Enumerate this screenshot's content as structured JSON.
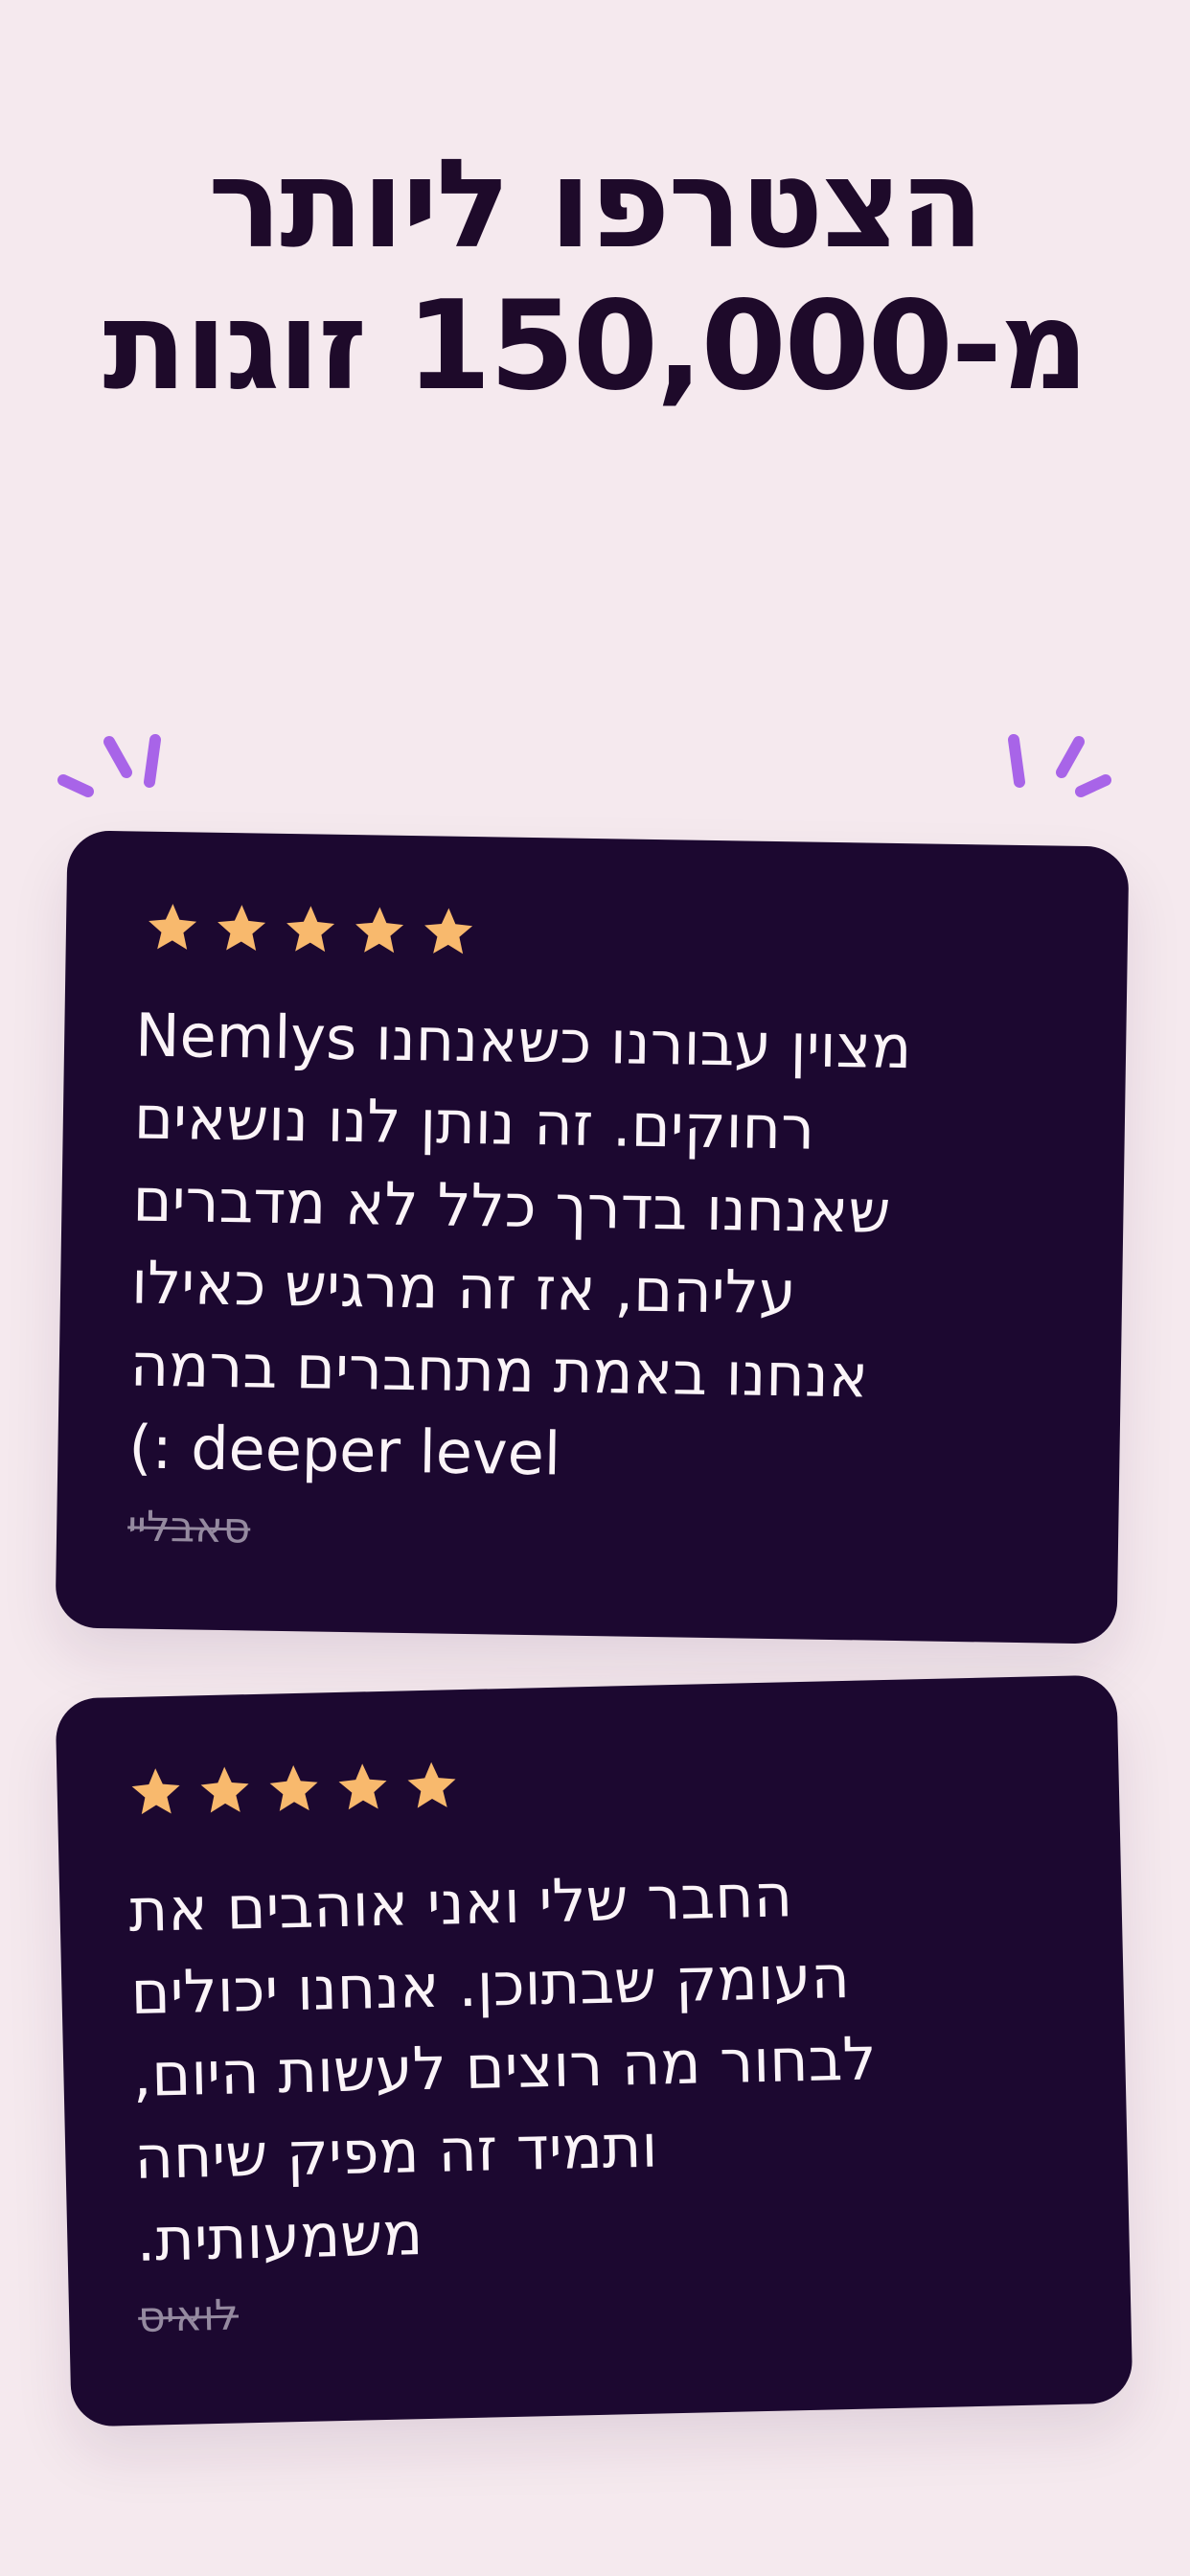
{
  "headline": {
    "line1": "הצטרפו ליותר",
    "line2": "מ-150,000 זוגות"
  },
  "colors": {
    "background": "#f5e9ee",
    "headline": "#1e0a2a",
    "card": "#1c0830",
    "card_text": "#fbf4f8",
    "star": "#f8b96d",
    "sparkle": "#a864e8",
    "author": "#958aa0"
  },
  "decorations": {
    "left_icon": "sparkle-burst-icon",
    "right_icon": "sparkle-burst-icon"
  },
  "reviews": [
    {
      "rating": 5,
      "star_icon": "star-icon",
      "lines": [
        "מצוין עבורנו כשאנחנו Nemlys",
        "רחוקים. זה נותן לנו נושאים",
        "שאנחנו בדרך כלל לא מדברים",
        "עליהם, אז זה מרגיש כאילו",
        "אנחנו באמת מתחברים ברמה",
        "deeper level :)"
      ],
      "author": "סאבליי"
    },
    {
      "rating": 5,
      "star_icon": "star-icon",
      "lines": [
        "החבר שלי ואני אוהבים את",
        "העומק שבתוכן. אנחנו יכולים",
        "לבחור מה רוצים לעשות היום,",
        "ותמיד זה מפיק שיחה",
        "משמעותית."
      ],
      "author": "לואיס"
    }
  ]
}
